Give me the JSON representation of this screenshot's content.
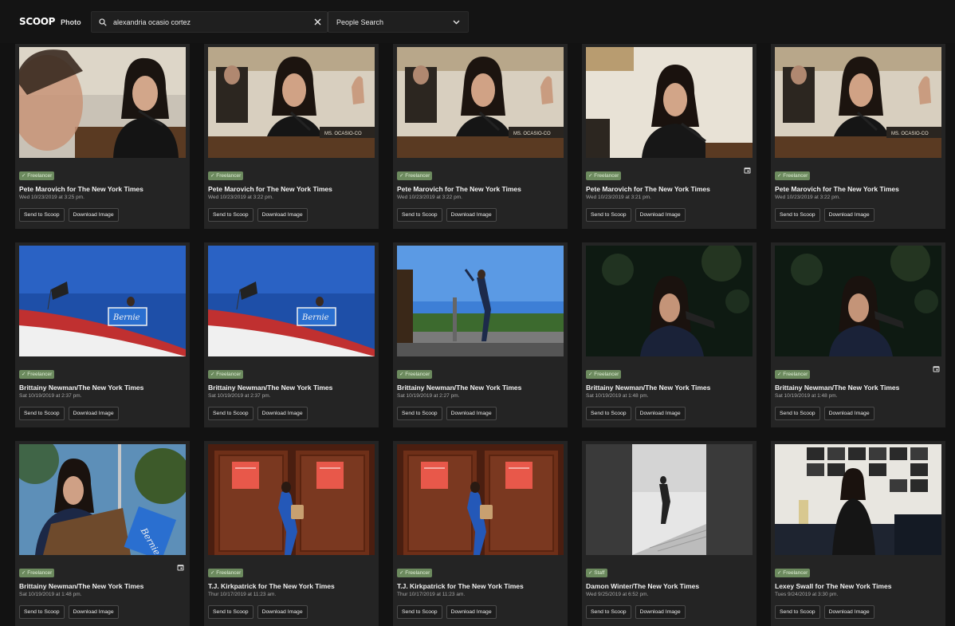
{
  "header": {
    "logo_brand": "SCOOP",
    "logo_product": "Photo",
    "search_value": "alexandria ocasio cortez",
    "search_mode": "People Search"
  },
  "colors": {
    "background": "#121212",
    "card": "#242424",
    "badge": "#6c8a5e"
  },
  "photos": [
    {
      "badge": "✓ Freelancer",
      "credit": "Pete Marovich for The New York Times",
      "date": "Wed 10/23/2019 at 3:25 pm.",
      "calendar": false,
      "send_label": "Send to Scoop",
      "download_label": "Download Image",
      "scene": "hearing-closeup"
    },
    {
      "badge": "✓ Freelancer",
      "credit": "Pete Marovich for The New York Times",
      "date": "Wed 10/23/2019 at 3:22 pm.",
      "calendar": false,
      "send_label": "Send to Scoop",
      "download_label": "Download Image",
      "scene": "hearing-nameplate"
    },
    {
      "badge": "✓ Freelancer",
      "credit": "Pete Marovich for The New York Times",
      "date": "Wed 10/23/2019 at 3:22 pm.",
      "calendar": false,
      "send_label": "Send to Scoop",
      "download_label": "Download Image",
      "scene": "hearing-nameplate"
    },
    {
      "badge": "✓ Freelancer",
      "credit": "Pete Marovich for The New York Times",
      "date": "Wed 10/23/2019 at 3:21 pm.",
      "calendar": true,
      "send_label": "Send to Scoop",
      "download_label": "Download Image",
      "scene": "hearing-light"
    },
    {
      "badge": "✓ Freelancer",
      "credit": "Pete Marovich for The New York Times",
      "date": "Wed 10/23/2019 at 3:22 pm.",
      "calendar": false,
      "send_label": "Send to Scoop",
      "download_label": "Download Image",
      "scene": "hearing-nameplate"
    },
    {
      "badge": "✓ Freelancer",
      "credit": "Brittainy Newman/The New York Times",
      "date": "Sat 10/19/2019 at 2:37 pm.",
      "calendar": false,
      "send_label": "Send to Scoop",
      "download_label": "Download Image",
      "scene": "rally-sky"
    },
    {
      "badge": "✓ Freelancer",
      "credit": "Brittainy Newman/The New York Times",
      "date": "Sat 10/19/2019 at 2:37 pm.",
      "calendar": false,
      "send_label": "Send to Scoop",
      "download_label": "Download Image",
      "scene": "rally-sky"
    },
    {
      "badge": "✓ Freelancer",
      "credit": "Brittainy Newman/The New York Times",
      "date": "Sat 10/19/2019 at 2:27 pm.",
      "calendar": false,
      "send_label": "Send to Scoop",
      "download_label": "Download Image",
      "scene": "rally-stage"
    },
    {
      "badge": "✓ Freelancer",
      "credit": "Brittainy Newman/The New York Times",
      "date": "Sat 10/19/2019 at 1:48 pm.",
      "calendar": false,
      "send_label": "Send to Scoop",
      "download_label": "Download Image",
      "scene": "rally-dark"
    },
    {
      "badge": "✓ Freelancer",
      "credit": "Brittainy Newman/The New York Times",
      "date": "Sat 10/19/2019 at 1:48 pm.",
      "calendar": true,
      "send_label": "Send to Scoop",
      "download_label": "Download Image",
      "scene": "rally-dark"
    },
    {
      "badge": "✓ Freelancer",
      "credit": "Brittainy Newman/The New York Times",
      "date": "Sat 10/19/2019 at 1:48 pm.",
      "calendar": true,
      "send_label": "Send to Scoop",
      "download_label": "Download Image",
      "scene": "podium-trees"
    },
    {
      "badge": "✓ Freelancer",
      "credit": "T.J. Kirkpatrick for The New York Times",
      "date": "Thur 10/17/2019 at 11:23 am.",
      "calendar": false,
      "send_label": "Send to Scoop",
      "download_label": "Download Image",
      "scene": "doors"
    },
    {
      "badge": "✓ Freelancer",
      "credit": "T.J. Kirkpatrick for The New York Times",
      "date": "Thur 10/17/2019 at 11:23 am.",
      "calendar": false,
      "send_label": "Send to Scoop",
      "download_label": "Download Image",
      "scene": "doors"
    },
    {
      "badge": "✓ Staff",
      "credit": "Damon Winter/The New York Times",
      "date": "Wed 9/25/2019 at 6:52 pm.",
      "calendar": false,
      "send_label": "Send to Scoop",
      "download_label": "Download Image",
      "scene": "stairs-bw"
    },
    {
      "badge": "✓ Freelancer",
      "credit": "Lexey Swall for The New York Times",
      "date": "Tues 9/24/2019 at 3:30 pm.",
      "calendar": false,
      "send_label": "Send to Scoop",
      "download_label": "Download Image",
      "scene": "office"
    }
  ]
}
